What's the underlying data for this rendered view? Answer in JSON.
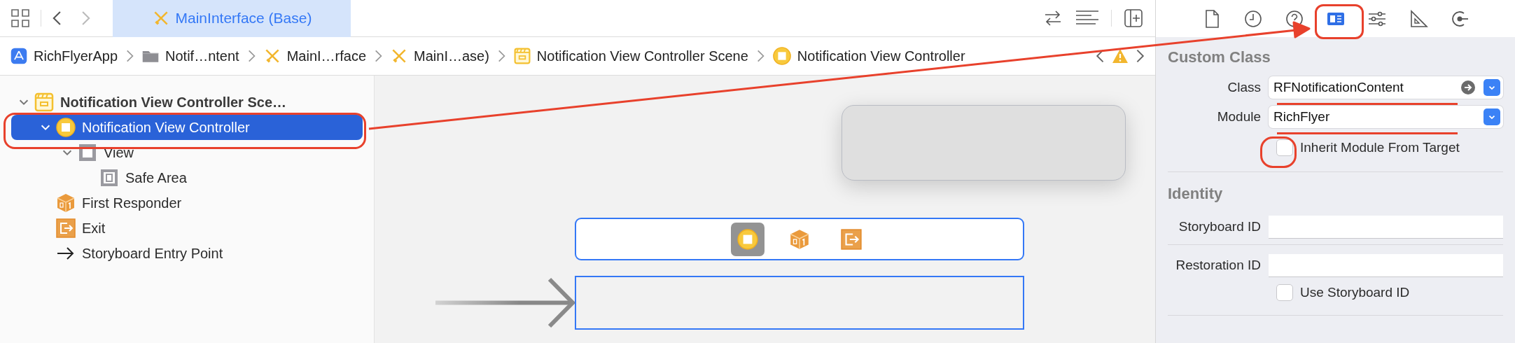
{
  "nav": {
    "back": {
      "disabled": false
    },
    "forward": {
      "disabled": true
    }
  },
  "editor_tab": {
    "label": "MainInterface (Base)",
    "selected": true
  },
  "breadcrumbs": [
    {
      "label": "RichFlyerApp",
      "kind": "app"
    },
    {
      "label": "Notif…ntent",
      "kind": "folder"
    },
    {
      "label": "MainI…rface",
      "kind": "storyboard"
    },
    {
      "label": "MainI…ase)",
      "kind": "storyboard"
    },
    {
      "label": "Notification View Controller Scene",
      "kind": "scene"
    },
    {
      "label": "Notification View Controller",
      "kind": "controller"
    }
  ],
  "outline": [
    {
      "label": "Notification View Controller Sce…",
      "kind": "scene",
      "expanded": true,
      "selected": false,
      "children": [
        {
          "label": "Notification View Controller",
          "kind": "controller",
          "expanded": true,
          "selected": true,
          "children": [
            {
              "label": "View",
              "kind": "view",
              "expanded": true,
              "selected": false,
              "children": [
                {
                  "label": "Safe Area",
                  "kind": "safe-area",
                  "selected": false
                }
              ]
            }
          ]
        },
        {
          "label": "First Responder",
          "kind": "responder",
          "selected": false
        },
        {
          "label": "Exit",
          "kind": "exit",
          "selected": false
        },
        {
          "label": "Storyboard Entry Point",
          "kind": "entry",
          "selected": false
        }
      ]
    }
  ],
  "canvas": {
    "dock": [
      {
        "kind": "controller",
        "selected": true
      },
      {
        "kind": "responder",
        "selected": false
      },
      {
        "kind": "exit",
        "selected": false
      }
    ]
  },
  "inspector": {
    "tabs": [
      {
        "kind": "file",
        "selected": false
      },
      {
        "kind": "history",
        "selected": false
      },
      {
        "kind": "help",
        "selected": false
      },
      {
        "kind": "identity",
        "selected": true
      },
      {
        "kind": "attributes",
        "selected": false
      },
      {
        "kind": "size",
        "selected": false
      },
      {
        "kind": "connections",
        "selected": false
      }
    ],
    "custom_class": {
      "title": "Custom Class",
      "class": {
        "label": "Class",
        "value": "RFNotificationContent"
      },
      "module": {
        "label": "Module",
        "value": "RichFlyer"
      },
      "inherit": {
        "label": "Inherit Module From Target",
        "checked": false
      }
    },
    "identity": {
      "title": "Identity",
      "storyboard_id": {
        "label": "Storyboard ID"
      },
      "restoration_id": {
        "label": "Restoration ID"
      },
      "use_storyboard_id": {
        "label": "Use Storyboard ID",
        "checked": false
      }
    }
  }
}
